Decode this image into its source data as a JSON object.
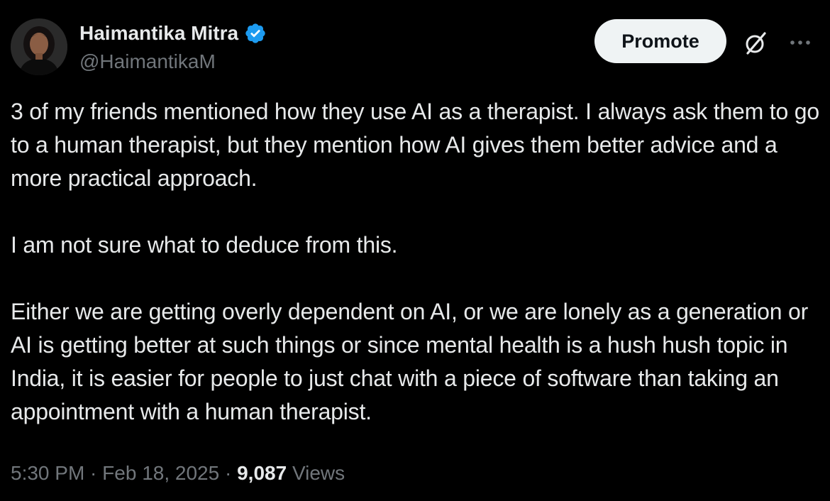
{
  "author": {
    "display_name": "Haimantika Mitra",
    "handle": "@HaimantikaM",
    "verified": true,
    "verified_color": "#1d9bf0"
  },
  "actions": {
    "promote_label": "Promote",
    "grok_icon": "grok-icon",
    "more_icon": "more-icon"
  },
  "tweet": {
    "paragraphs": [
      "3 of my friends mentioned how they use AI as a therapist. I always ask them to go to a human therapist, but they mention how AI gives them better advice and a more practical approach.",
      "I am not sure what to deduce from this.",
      "Either we are getting overly dependent on AI, or we are lonely as a generation or AI is getting better at such things or since mental health is a hush hush topic in India, it is easier for people to just chat with a piece of software than taking an appointment with a human therapist."
    ]
  },
  "meta": {
    "time": "5:30 PM",
    "separator": " · ",
    "date": "Feb 18, 2025",
    "views_count": "9,087",
    "views_label": "Views"
  },
  "colors": {
    "background": "#000000",
    "text_primary": "#e7e9ea",
    "text_secondary": "#71767b",
    "promote_bg": "#eff3f4"
  }
}
